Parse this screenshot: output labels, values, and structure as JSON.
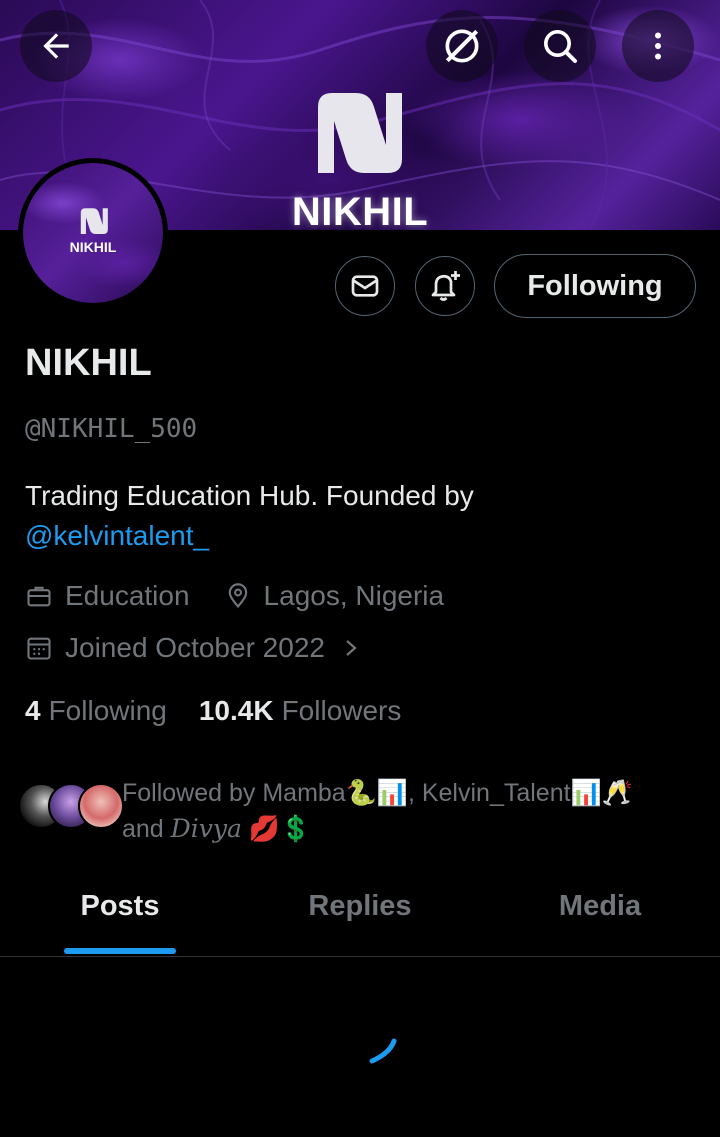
{
  "banner": {
    "brand_text": "NIKHIL"
  },
  "avatar": {
    "brand_text": "NIKHIL"
  },
  "top_bar": {
    "back_icon": "arrow-left-icon",
    "grok_icon": "grok-icon",
    "search_icon": "search-icon",
    "more_icon": "more-vertical-icon"
  },
  "actions": {
    "message_icon": "envelope-icon",
    "notify_icon": "bell-plus-icon",
    "following_label": "Following"
  },
  "profile": {
    "name": "NIKHIL",
    "handle": "@NIKHIL_500",
    "bio_text": "Trading Education Hub.  Founded by",
    "bio_mention": "@kelvintalent_",
    "category": "Education",
    "location": "Lagos, Nigeria",
    "joined": "Joined October 2022"
  },
  "stats": {
    "following_count": "4",
    "following_label": "Following",
    "followers_count": "10.4K",
    "followers_label": "Followers"
  },
  "followed_by": {
    "line1": "Followed by Mamba🐍📊, Kelvin_Talent📊🥂",
    "line2_prefix": "and ",
    "line2_name": "𝐷𝑖𝑣𝑦𝑎",
    "line2_suffix": " 💋💲"
  },
  "tabs": [
    {
      "label": "Posts",
      "active": true
    },
    {
      "label": "Replies",
      "active": false
    },
    {
      "label": "Media",
      "active": false
    }
  ],
  "colors": {
    "accent": "#1d9bf0",
    "background": "#000000",
    "muted": "#71767b",
    "banner_purple": "#4a168e"
  }
}
